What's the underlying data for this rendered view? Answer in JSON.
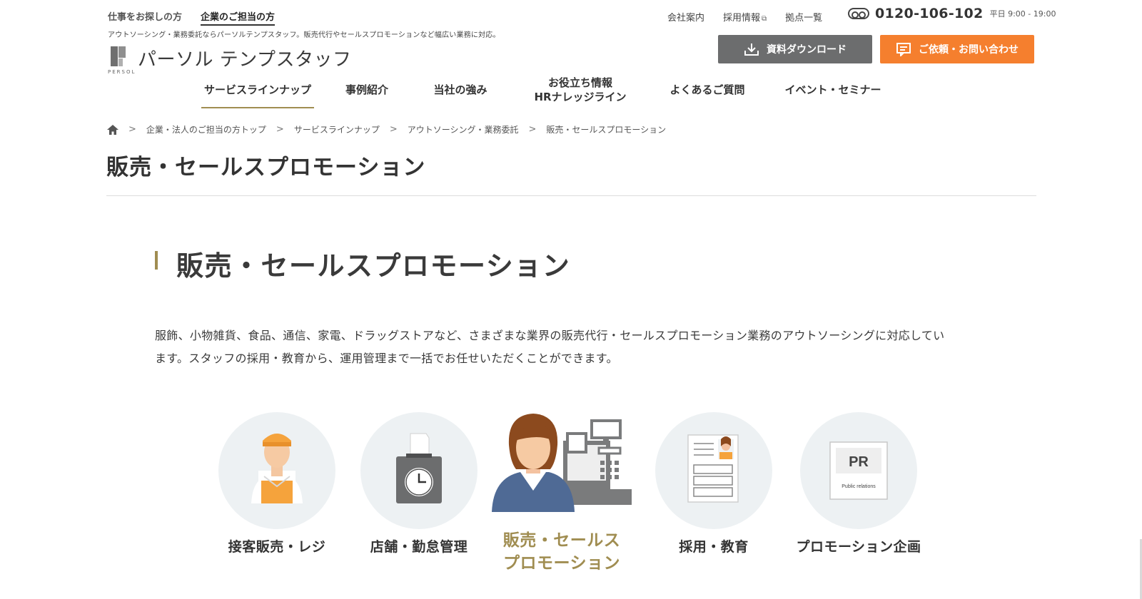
{
  "header": {
    "top_tabs": [
      "仕事をお探しの方",
      "企業のご担当の方"
    ],
    "tagline": "アウトソーシング・業務委託ならパーソルテンプスタッフ。販売代行やセールスプロモーションなど幅広い業務に対応。",
    "logo_text": "パーソル テンプスタッフ",
    "logo_sub": "PERSOL",
    "util_links": [
      "会社案内",
      "採用情報",
      "拠点一覧"
    ],
    "phone_number": "0120-106-102",
    "phone_hours": "平日 9:00 - 19:00",
    "download_label": "資料ダウンロード",
    "contact_label": "ご依頼・お問い合わせ"
  },
  "nav": {
    "items": [
      "サービスラインナップ",
      "事例紹介",
      "当社の強み",
      "お役立ち情報",
      "HRナレッジライン",
      "よくあるご質問",
      "イベント・セミナー"
    ]
  },
  "breadcrumb": [
    "企業・法人のご担当の方トップ",
    "サービスラインナップ",
    "アウトソーシング・業務委託",
    "販売・セールスプロモーション"
  ],
  "page": {
    "title": "販売・セールスプロモーション",
    "section_title": "販売・セールスプロモーション",
    "description_line1": "服飾、小物雑貨、食品、通信、家電、ドラッグストアなど、さまざまな業界の販売代行・セールスプロモーション業務のアウトソーシングに対応してい",
    "description_line2": "ます。スタッフの採用・教育から、運用管理まで一括でお任せいただくことができます。"
  },
  "services": {
    "items": [
      "接客販売・レジ",
      "店舗・勤怠管理",
      "販売・セールス",
      "プロモーション",
      "採用・教育",
      "プロモーション企画"
    ],
    "pr_text": "PR",
    "pr_sub": "Public relations"
  },
  "colors": {
    "accent_gold": "#a08d51",
    "orange": "#f57f2e",
    "gray_button": "#6c6d6e"
  }
}
